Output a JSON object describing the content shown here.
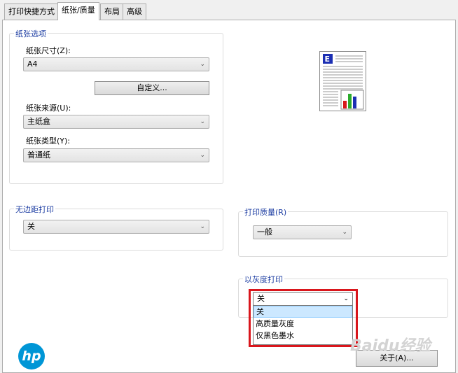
{
  "tabs": [
    "打印快捷方式",
    "纸张/质量",
    "布局",
    "高级"
  ],
  "paper_options": {
    "title": "纸张选项",
    "size_label": "纸张尺寸(Z):",
    "size_value": "A4",
    "custom_button": "自定义...",
    "source_label": "纸张来源(U):",
    "source_value": "主纸盒",
    "type_label": "纸张类型(Y):",
    "type_value": "普通纸"
  },
  "borderless": {
    "title": "无边距打印",
    "value": "关"
  },
  "print_quality": {
    "title": "打印质量(R)",
    "value": "一般"
  },
  "grayscale": {
    "title": "以灰度打印",
    "value": "关",
    "options": [
      "关",
      "高质量灰度",
      "仅黑色墨水"
    ]
  },
  "preview": {
    "letter": "E"
  },
  "about_button": "关于(A)...",
  "logo_text": "hp",
  "watermark_text": "Baidu经验",
  "colors": {
    "accent": "#1f3fa3",
    "highlight": "#d9161c",
    "hp_blue": "#0096d6"
  }
}
